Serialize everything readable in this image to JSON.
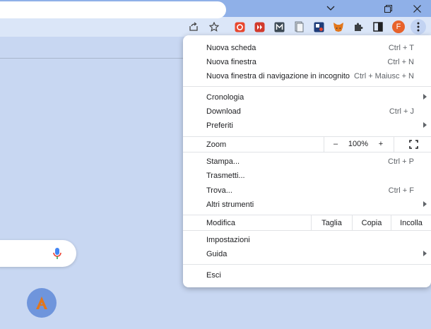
{
  "window": {
    "controls": [
      "chevron-down",
      "restore",
      "close"
    ]
  },
  "profile": {
    "initial": "F"
  },
  "menu": {
    "group1": [
      {
        "label": "Nuova scheda",
        "shortcut": "Ctrl + T"
      },
      {
        "label": "Nuova finestra",
        "shortcut": "Ctrl + N"
      },
      {
        "label": "Nuova finestra di navigazione in incognito",
        "shortcut": "Ctrl + Maiusc + N"
      }
    ],
    "group2": [
      {
        "label": "Cronologia",
        "shortcut": ""
      },
      {
        "label": "Download",
        "shortcut": "Ctrl + J"
      },
      {
        "label": "Preferiti",
        "shortcut": ""
      }
    ],
    "zoom": {
      "label": "Zoom",
      "minus": "–",
      "value": "100%",
      "plus": "+"
    },
    "group3": [
      {
        "label": "Stampa...",
        "shortcut": "Ctrl + P"
      },
      {
        "label": "Trasmetti...",
        "shortcut": ""
      },
      {
        "label": "Trova...",
        "shortcut": "Ctrl + F"
      },
      {
        "label": "Altri strumenti",
        "shortcut": ""
      }
    ],
    "edit": {
      "label": "Modifica",
      "cut": "Taglia",
      "copy": "Copia",
      "paste": "Incolla"
    },
    "group4": [
      {
        "label": "Impostazioni"
      },
      {
        "label": "Guida"
      }
    ],
    "exit": {
      "label": "Esci"
    }
  },
  "colors": {
    "titlebar": "#8fb0e8",
    "toolbar": "#dbe6f8",
    "page_bg": "#c8d7f2",
    "avatar": "#e8632b",
    "shortcut_circle": "#6f95dc",
    "mic_blue": "#4285f4",
    "mic_red": "#ea4335"
  }
}
